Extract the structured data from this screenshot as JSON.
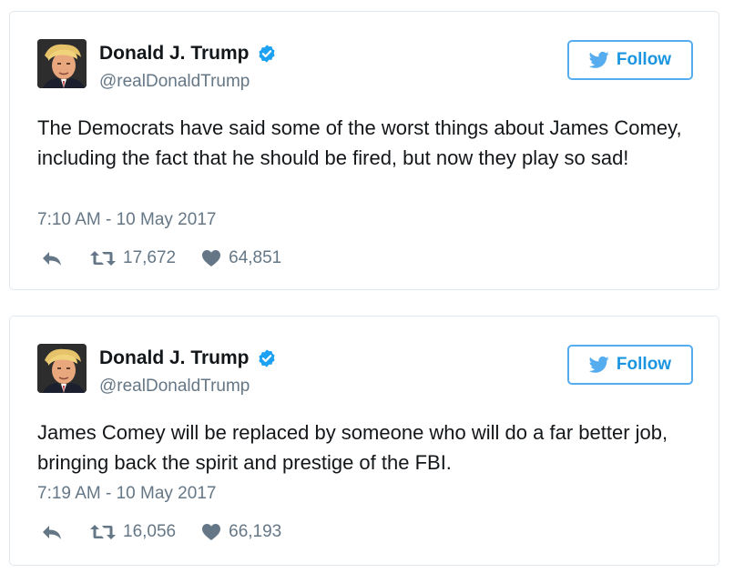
{
  "tweets": [
    {
      "name": "Donald J. Trump",
      "handle": "@realDonaldTrump",
      "follow_label": "Follow",
      "text": "The Democrats have said some of the worst things about James Comey, including the fact that he should be fired, but now they play so sad!",
      "timestamp": "7:10 AM - 10 May 2017",
      "retweets": "17,672",
      "likes": "64,851"
    },
    {
      "name": "Donald J. Trump",
      "handle": "@realDonaldTrump",
      "follow_label": "Follow",
      "text": "James Comey will be replaced by someone who will do a far better job, bringing back the spirit and prestige of the FBI.",
      "timestamp": "7:19 AM - 10 May 2017",
      "retweets": "16,056",
      "likes": "66,193"
    }
  ],
  "colors": {
    "accent": "#1b95e0",
    "follow_border": "#55acee",
    "text": "#14171a",
    "secondary": "#657786",
    "border": "#e1e8ed",
    "verified": "#1da1f2"
  },
  "icons": [
    "avatar",
    "verified-badge-icon",
    "twitter-bird-icon",
    "reply-icon",
    "retweet-icon",
    "heart-icon"
  ]
}
